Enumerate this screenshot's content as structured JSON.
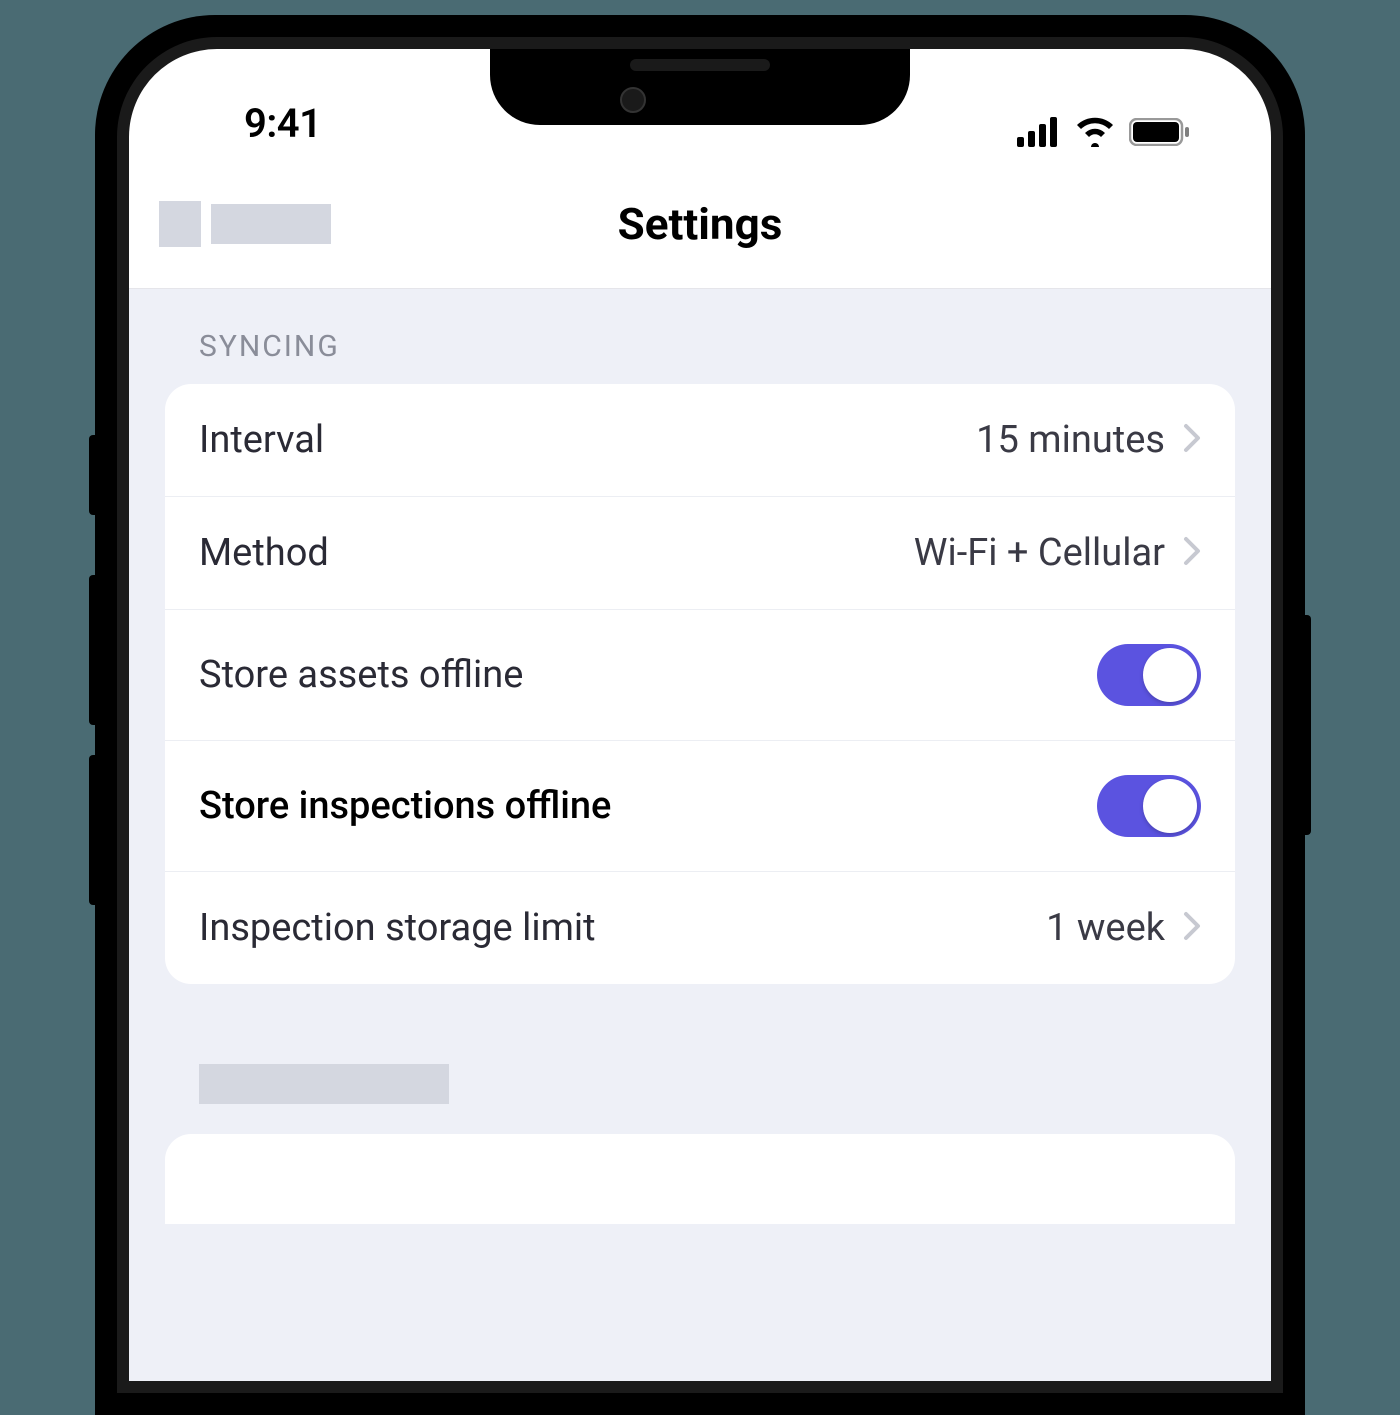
{
  "status": {
    "time": "9:41"
  },
  "nav": {
    "title": "Settings"
  },
  "sections": {
    "syncing": {
      "header": "SYNCING",
      "rows": {
        "interval": {
          "label": "Interval",
          "value": "15 minutes"
        },
        "method": {
          "label": "Method",
          "value": "Wi-Fi + Cellular"
        },
        "storeAssets": {
          "label": "Store assets offline"
        },
        "storeInspections": {
          "label": "Store inspections offline"
        },
        "storageLimit": {
          "label": "Inspection storage limit",
          "value": "1 week"
        }
      }
    }
  }
}
